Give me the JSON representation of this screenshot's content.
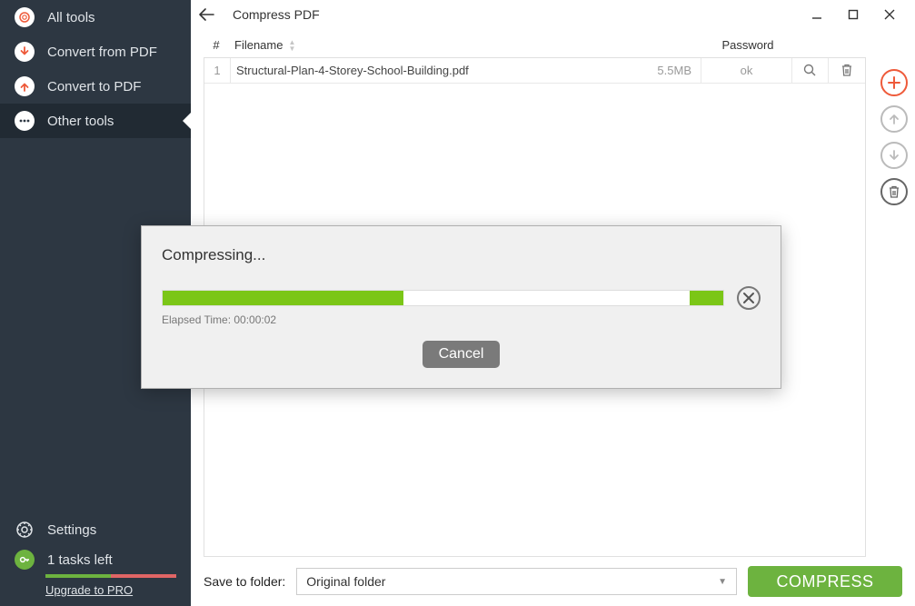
{
  "sidebar": {
    "items": [
      {
        "label": "All tools"
      },
      {
        "label": "Convert from PDF"
      },
      {
        "label": "Convert to PDF"
      },
      {
        "label": "Other tools"
      }
    ],
    "settings_label": "Settings",
    "tasks_label": "1 tasks left",
    "upgrade_label": "Upgrade to PRO"
  },
  "header": {
    "title": "Compress PDF"
  },
  "table": {
    "col_num": "#",
    "col_filename": "Filename",
    "col_password": "Password",
    "rows": [
      {
        "num": "1",
        "filename": "Structural-Plan-4-Storey-School-Building.pdf",
        "size": "5.5MB",
        "password": "ok"
      }
    ]
  },
  "footer": {
    "save_label": "Save to folder:",
    "folder_value": "Original folder",
    "compress_label": "COMPRESS"
  },
  "modal": {
    "title": "Compressing...",
    "elapsed_prefix": "Elapsed Time: ",
    "elapsed_value": "00:00:02",
    "cancel_label": "Cancel",
    "progress_percent": 43,
    "progress_tail_percent": 6
  }
}
